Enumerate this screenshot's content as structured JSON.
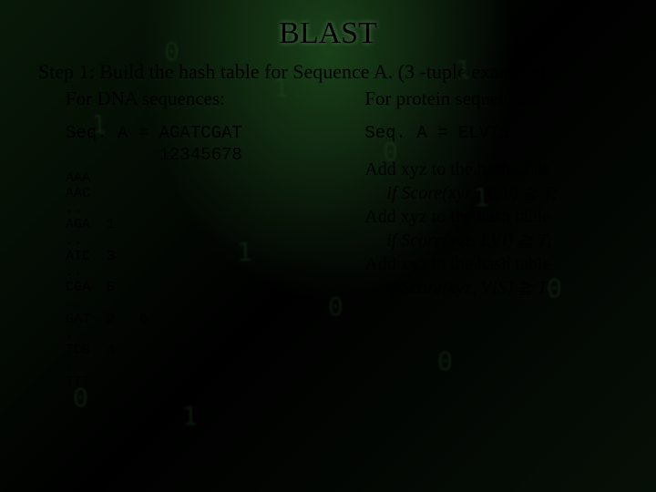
{
  "title": "BLAST",
  "step_line": "Step 1: Build the hash table for Sequence A. (3 -tuple example)",
  "left": {
    "heading": "For DNA sequences:",
    "seq_label": "Seq. A = AGATCGAT",
    "seq_index": "         12345678",
    "hash_rows": [
      {
        "kmer": "AAA",
        "pos": ""
      },
      {
        "kmer": "AAC",
        "pos": ""
      },
      {
        "kmer": "..",
        "pos": ""
      },
      {
        "kmer": "AGA",
        "pos": "1"
      },
      {
        "kmer": "..",
        "pos": ""
      },
      {
        "kmer": "ATC",
        "pos": "3"
      },
      {
        "kmer": "..",
        "pos": ""
      },
      {
        "kmer": "CGA",
        "pos": "5"
      },
      {
        "kmer": "..",
        "pos": ""
      },
      {
        "kmer": "GAT",
        "pos": "2   6"
      },
      {
        "kmer": "..",
        "pos": ""
      },
      {
        "kmer": "TCG",
        "pos": "4"
      },
      {
        "kmer": "..",
        "pos": ""
      },
      {
        "kmer": "TTT",
        "pos": ""
      }
    ]
  },
  "right": {
    "heading": "For protein sequences:",
    "seq_label": "Seq. A = ELVIS",
    "rules": [
      {
        "lead": "Add xyz to the hash table",
        "cond": "if Score(xyz, ELV) ≧ T;"
      },
      {
        "lead": "Add xyz to the hash table",
        "cond": "if Score(xyz, LVI) ≧ T;"
      },
      {
        "lead": "Add xyz to the hash table",
        "cond": "if Score(xyz, VIS) ≧ T;"
      }
    ]
  }
}
